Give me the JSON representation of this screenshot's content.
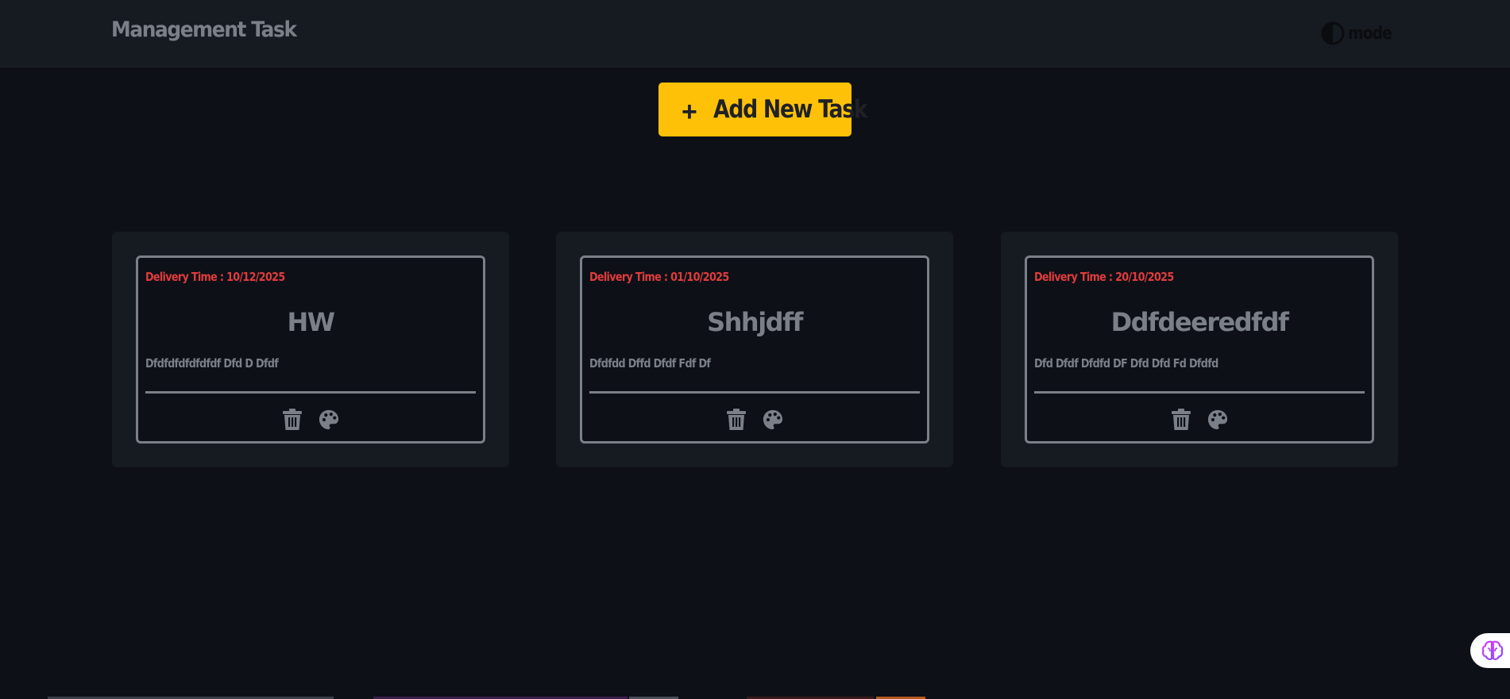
{
  "header": {
    "brand": "Management Task",
    "mode_label": "mode"
  },
  "add_button": {
    "label": "Add New Task",
    "icon": "plus-icon",
    "color": "#ffc107"
  },
  "cards": [
    {
      "delivery": "Delivery Time : 10/12/2025",
      "title": "HW",
      "description": "Dfdfdfdfdfdfdf Dfd D Dfdf"
    },
    {
      "delivery": "Delivery Time : 01/10/2025",
      "title": "Shhjdff",
      "description": "Dfdfdd Dffd Dfdf Fdf Df"
    },
    {
      "delivery": "Delivery Time : 20/10/2025",
      "title": "Ddfdeeredfdf",
      "description": "Dfd Dfdf Dfdfd DF Dfd Dfd Fd Dfdfd"
    }
  ],
  "icons": {
    "delete": "trash-icon",
    "color": "palette-icon",
    "theme": "contrast-icon",
    "assistant": "brain-icon"
  },
  "colors": {
    "background": "#0d1017",
    "header": "#161a21",
    "accent": "#ffc107",
    "muted_text": "#7b8088",
    "delivery_text": "#e03c3c"
  }
}
